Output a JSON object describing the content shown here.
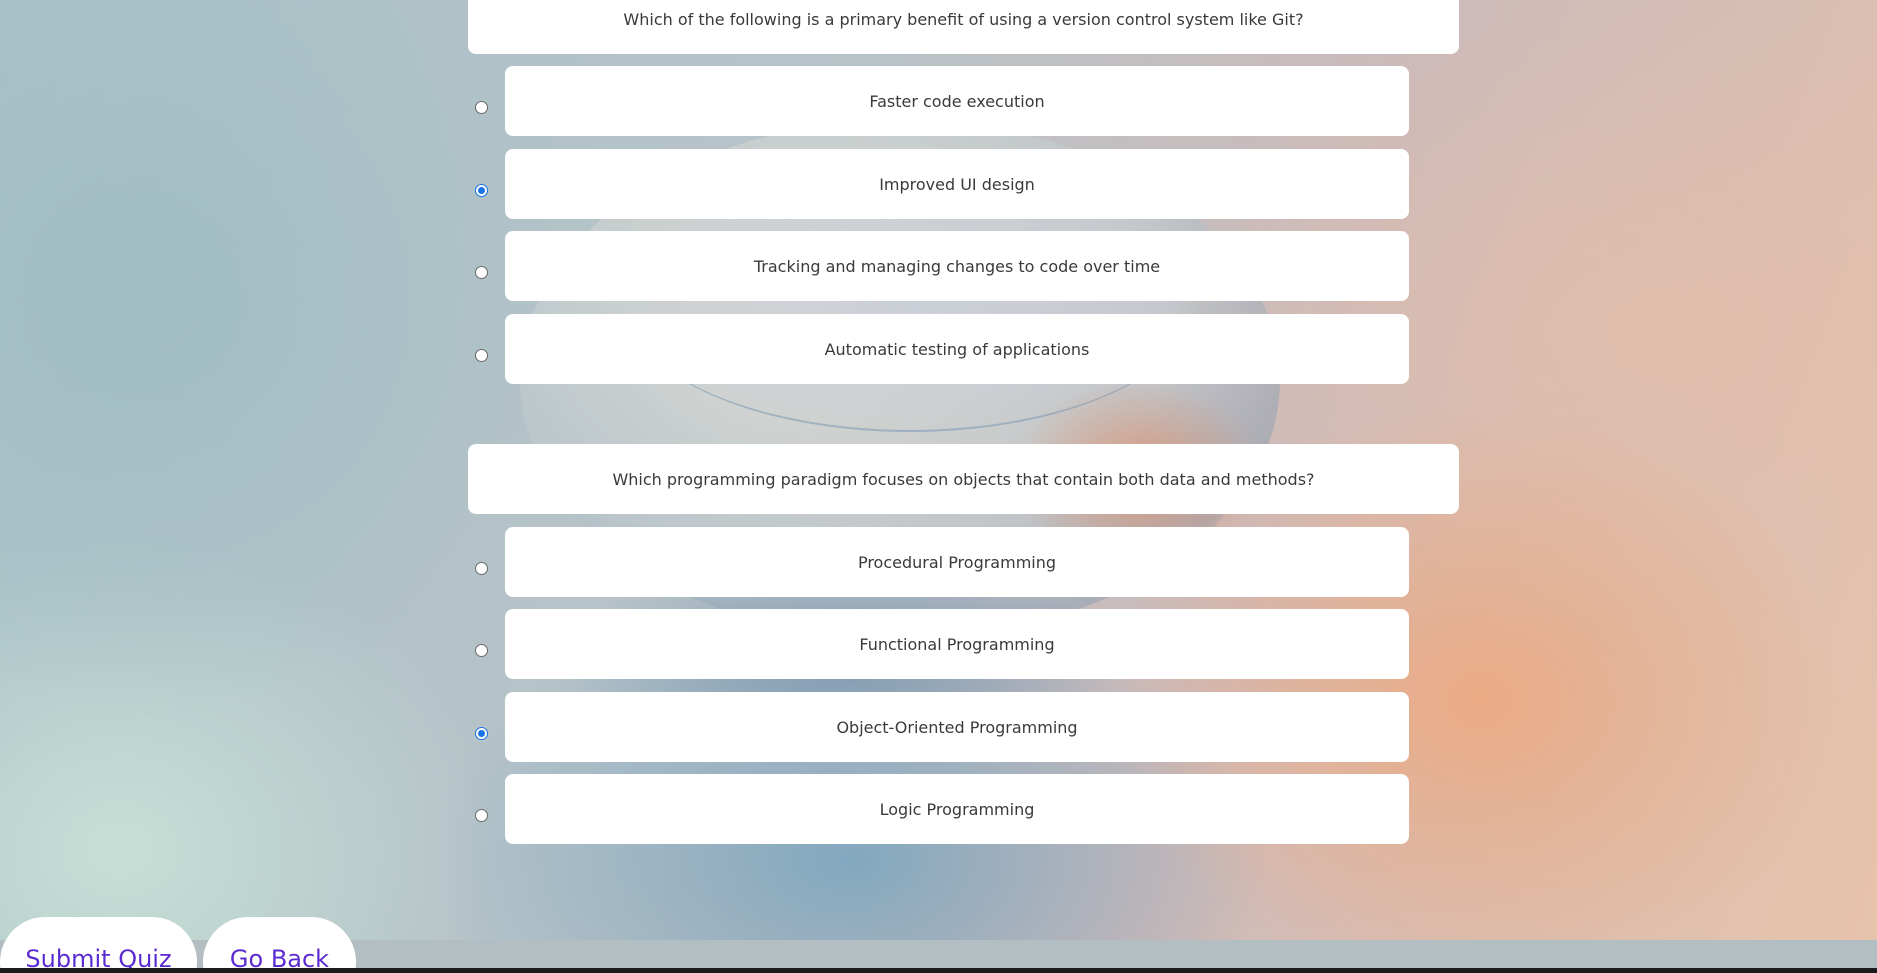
{
  "quiz": {
    "questions": [
      {
        "text": "Which of the following is a primary benefit of using a version control system like Git?",
        "options": [
          {
            "label": "Faster code execution",
            "selected": false
          },
          {
            "label": "Improved UI design",
            "selected": true
          },
          {
            "label": "Tracking and managing changes to code over time",
            "selected": false
          },
          {
            "label": "Automatic testing of applications",
            "selected": false
          }
        ]
      },
      {
        "text": "Which programming paradigm focuses on objects that contain both data and methods?",
        "options": [
          {
            "label": "Procedural Programming",
            "selected": false
          },
          {
            "label": "Functional Programming",
            "selected": false
          },
          {
            "label": "Object-Oriented Programming",
            "selected": true
          },
          {
            "label": "Logic Programming",
            "selected": false
          }
        ]
      }
    ]
  },
  "actions": {
    "submit_label": "Submit Quiz",
    "back_label": "Go Back"
  },
  "colors": {
    "card_background": "#ffffff",
    "text": "#3a3a3a",
    "radio_accent": "#1a73e8",
    "button_text": "#5b2bd1"
  }
}
